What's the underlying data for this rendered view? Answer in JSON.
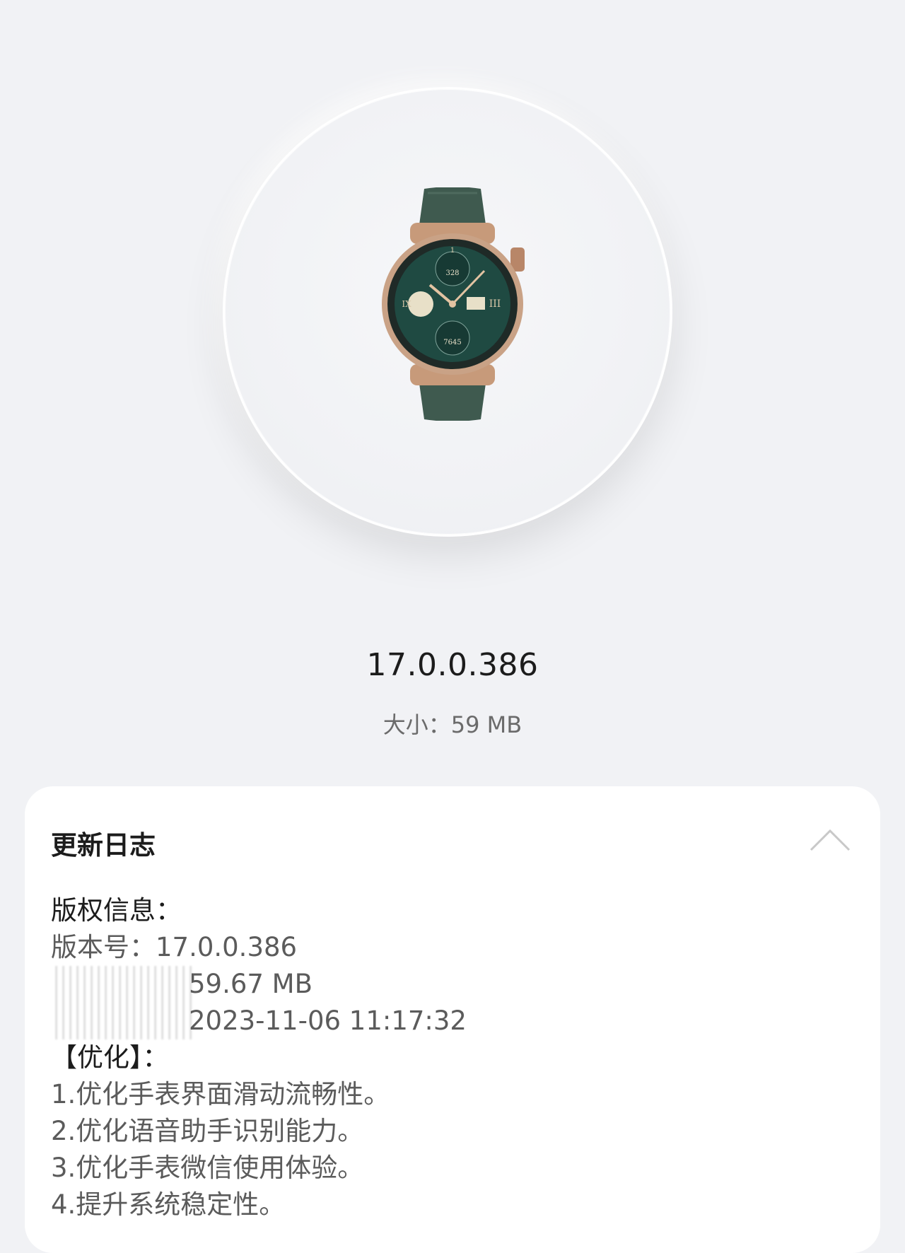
{
  "hero": {
    "image_icon": "smartwatch-icon"
  },
  "version": "17.0.0.386",
  "size_text": "大小：59 MB",
  "changelog": {
    "title": "更新日志",
    "collapse_icon": "chevron-up-icon",
    "lines": {
      "copyright": "版权信息：",
      "version": "版本号：17.0.0.386",
      "package_size": "59.67 MB",
      "release_time": "2023-11-06 11:17:32",
      "optimization_header": "【优化】：",
      "item1": "1.优化手表界面滑动流畅性。",
      "item2": "2.优化语音助手识别能力。",
      "item3": "3.优化手表微信使用体验。",
      "item4": "4.提升系统稳定性。"
    }
  }
}
